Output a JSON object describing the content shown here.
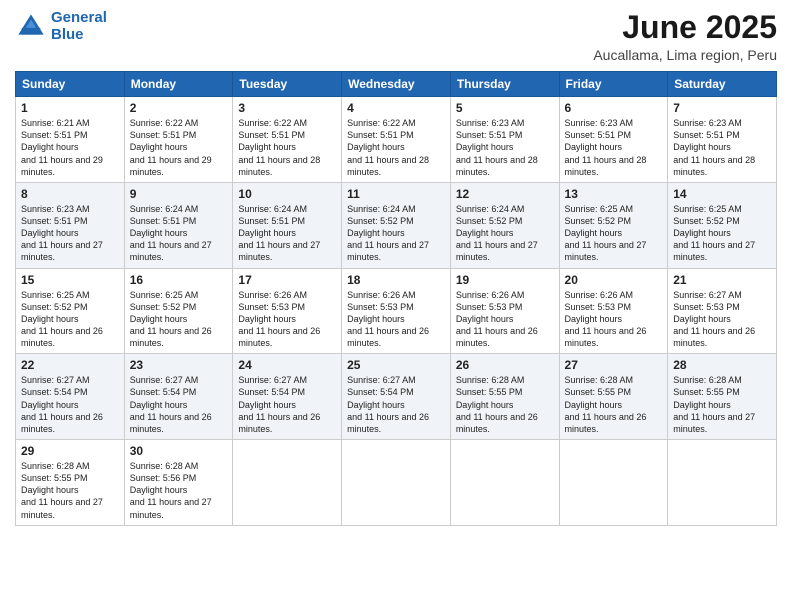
{
  "logo": {
    "line1": "General",
    "line2": "Blue"
  },
  "title": "June 2025",
  "location": "Aucallama, Lima region, Peru",
  "days_header": [
    "Sunday",
    "Monday",
    "Tuesday",
    "Wednesday",
    "Thursday",
    "Friday",
    "Saturday"
  ],
  "weeks": [
    [
      {
        "num": "1",
        "rise": "6:21 AM",
        "set": "5:51 PM",
        "hours": "11 hours and 29 minutes."
      },
      {
        "num": "2",
        "rise": "6:22 AM",
        "set": "5:51 PM",
        "hours": "11 hours and 29 minutes."
      },
      {
        "num": "3",
        "rise": "6:22 AM",
        "set": "5:51 PM",
        "hours": "11 hours and 28 minutes."
      },
      {
        "num": "4",
        "rise": "6:22 AM",
        "set": "5:51 PM",
        "hours": "11 hours and 28 minutes."
      },
      {
        "num": "5",
        "rise": "6:23 AM",
        "set": "5:51 PM",
        "hours": "11 hours and 28 minutes."
      },
      {
        "num": "6",
        "rise": "6:23 AM",
        "set": "5:51 PM",
        "hours": "11 hours and 28 minutes."
      },
      {
        "num": "7",
        "rise": "6:23 AM",
        "set": "5:51 PM",
        "hours": "11 hours and 28 minutes."
      }
    ],
    [
      {
        "num": "8",
        "rise": "6:23 AM",
        "set": "5:51 PM",
        "hours": "11 hours and 27 minutes."
      },
      {
        "num": "9",
        "rise": "6:24 AM",
        "set": "5:51 PM",
        "hours": "11 hours and 27 minutes."
      },
      {
        "num": "10",
        "rise": "6:24 AM",
        "set": "5:51 PM",
        "hours": "11 hours and 27 minutes."
      },
      {
        "num": "11",
        "rise": "6:24 AM",
        "set": "5:52 PM",
        "hours": "11 hours and 27 minutes."
      },
      {
        "num": "12",
        "rise": "6:24 AM",
        "set": "5:52 PM",
        "hours": "11 hours and 27 minutes."
      },
      {
        "num": "13",
        "rise": "6:25 AM",
        "set": "5:52 PM",
        "hours": "11 hours and 27 minutes."
      },
      {
        "num": "14",
        "rise": "6:25 AM",
        "set": "5:52 PM",
        "hours": "11 hours and 27 minutes."
      }
    ],
    [
      {
        "num": "15",
        "rise": "6:25 AM",
        "set": "5:52 PM",
        "hours": "11 hours and 26 minutes."
      },
      {
        "num": "16",
        "rise": "6:25 AM",
        "set": "5:52 PM",
        "hours": "11 hours and 26 minutes."
      },
      {
        "num": "17",
        "rise": "6:26 AM",
        "set": "5:53 PM",
        "hours": "11 hours and 26 minutes."
      },
      {
        "num": "18",
        "rise": "6:26 AM",
        "set": "5:53 PM",
        "hours": "11 hours and 26 minutes."
      },
      {
        "num": "19",
        "rise": "6:26 AM",
        "set": "5:53 PM",
        "hours": "11 hours and 26 minutes."
      },
      {
        "num": "20",
        "rise": "6:26 AM",
        "set": "5:53 PM",
        "hours": "11 hours and 26 minutes."
      },
      {
        "num": "21",
        "rise": "6:27 AM",
        "set": "5:53 PM",
        "hours": "11 hours and 26 minutes."
      }
    ],
    [
      {
        "num": "22",
        "rise": "6:27 AM",
        "set": "5:54 PM",
        "hours": "11 hours and 26 minutes."
      },
      {
        "num": "23",
        "rise": "6:27 AM",
        "set": "5:54 PM",
        "hours": "11 hours and 26 minutes."
      },
      {
        "num": "24",
        "rise": "6:27 AM",
        "set": "5:54 PM",
        "hours": "11 hours and 26 minutes."
      },
      {
        "num": "25",
        "rise": "6:27 AM",
        "set": "5:54 PM",
        "hours": "11 hours and 26 minutes."
      },
      {
        "num": "26",
        "rise": "6:28 AM",
        "set": "5:55 PM",
        "hours": "11 hours and 26 minutes."
      },
      {
        "num": "27",
        "rise": "6:28 AM",
        "set": "5:55 PM",
        "hours": "11 hours and 26 minutes."
      },
      {
        "num": "28",
        "rise": "6:28 AM",
        "set": "5:55 PM",
        "hours": "11 hours and 27 minutes."
      }
    ],
    [
      {
        "num": "29",
        "rise": "6:28 AM",
        "set": "5:55 PM",
        "hours": "11 hours and 27 minutes."
      },
      {
        "num": "30",
        "rise": "6:28 AM",
        "set": "5:56 PM",
        "hours": "11 hours and 27 minutes."
      },
      null,
      null,
      null,
      null,
      null
    ]
  ]
}
